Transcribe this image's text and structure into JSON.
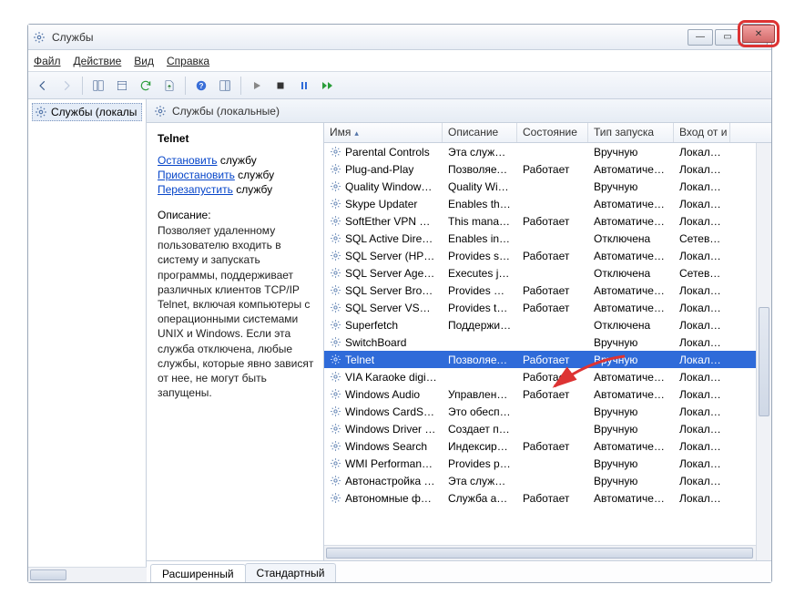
{
  "window": {
    "title": "Службы"
  },
  "menu": {
    "file": "Файл",
    "action": "Действие",
    "view": "Вид",
    "help": "Справка"
  },
  "tree": {
    "root": "Службы (локалы"
  },
  "rightHeader": "Службы (локальные)",
  "detail": {
    "name": "Telnet",
    "stop": "Остановить",
    "stop_suffix": " службу",
    "pause": "Приостановить",
    "pause_suffix": " службу",
    "restart": "Перезапустить",
    "restart_suffix": " службу",
    "desc_label": "Описание:",
    "desc": "Позволяет удаленному пользователю входить в систему и запускать программы, поддерживает различных клиентов TCP/IP Telnet, включая компьютеры с операционными системами UNIX и Windows. Если эта служба отключена, любые службы, которые явно зависят от нее, не могут быть запущены."
  },
  "columns": {
    "name": "Имя",
    "desc": "Описание",
    "state": "Состояние",
    "start": "Тип запуска",
    "logon": "Вход от и"
  },
  "tabs": {
    "extended": "Расширенный",
    "standard": "Стандартный"
  },
  "services": [
    {
      "name": "Parental Controls",
      "desc": "Эта служб…",
      "state": "",
      "start": "Вручную",
      "logon": "Локальна"
    },
    {
      "name": "Plug-and-Play",
      "desc": "Позволяет…",
      "state": "Работает",
      "start": "Автоматиче…",
      "logon": "Локальна"
    },
    {
      "name": "Quality Windows …",
      "desc": "Quality Wi…",
      "state": "",
      "start": "Вручную",
      "logon": "Локальна"
    },
    {
      "name": "Skype Updater",
      "desc": "Enables th…",
      "state": "",
      "start": "Автоматиче…",
      "logon": "Локальна"
    },
    {
      "name": "SoftEther VPN Cli…",
      "desc": "This mana…",
      "state": "Работает",
      "start": "Автоматиче…",
      "logon": "Локальна"
    },
    {
      "name": "SQL Active Direct…",
      "desc": "Enables int…",
      "state": "",
      "start": "Отключена",
      "logon": "Сетевая с"
    },
    {
      "name": "SQL Server (HPDS…",
      "desc": "Provides st…",
      "state": "Работает",
      "start": "Автоматиче…",
      "logon": "Локальна"
    },
    {
      "name": "SQL Server Agent …",
      "desc": "Executes jo…",
      "state": "",
      "start": "Отключена",
      "logon": "Сетевая с"
    },
    {
      "name": "SQL Server Browser",
      "desc": "Provides S…",
      "state": "Работает",
      "start": "Автоматиче…",
      "logon": "Локальна"
    },
    {
      "name": "SQL Server VSS Wr…",
      "desc": "Provides th…",
      "state": "Работает",
      "start": "Автоматиче…",
      "logon": "Локальна"
    },
    {
      "name": "Superfetch",
      "desc": "Поддержи…",
      "state": "",
      "start": "Отключена",
      "logon": "Локальна"
    },
    {
      "name": "SwitchBoard",
      "desc": "",
      "state": "",
      "start": "Вручную",
      "logon": "Локальна"
    },
    {
      "name": "Telnet",
      "desc": "Позволяет…",
      "state": "Работает",
      "start": "Вручную",
      "logon": "Локальна",
      "selected": true
    },
    {
      "name": "VIA Karaoke digita…",
      "desc": "",
      "state": "Работает",
      "start": "Автоматиче…",
      "logon": "Локальна"
    },
    {
      "name": "Windows Audio",
      "desc": "Управлен…",
      "state": "Работает",
      "start": "Автоматиче…",
      "logon": "Локальна"
    },
    {
      "name": "Windows CardSpa…",
      "desc": "Это обесп…",
      "state": "",
      "start": "Вручную",
      "logon": "Локальна"
    },
    {
      "name": "Windows Driver F…",
      "desc": "Создает п…",
      "state": "",
      "start": "Вручную",
      "logon": "Локальна"
    },
    {
      "name": "Windows Search",
      "desc": "Индексиро…",
      "state": "Работает",
      "start": "Автоматиче…",
      "logon": "Локальна"
    },
    {
      "name": "WMI Performance…",
      "desc": "Provides p…",
      "state": "",
      "start": "Вручную",
      "logon": "Локальна"
    },
    {
      "name": "Автонастройка W…",
      "desc": "Эта служб…",
      "state": "",
      "start": "Вручную",
      "logon": "Локальна"
    },
    {
      "name": "Автономные фай…",
      "desc": "Служба ав…",
      "state": "Работает",
      "start": "Автоматиче…",
      "logon": "Локальна"
    }
  ]
}
